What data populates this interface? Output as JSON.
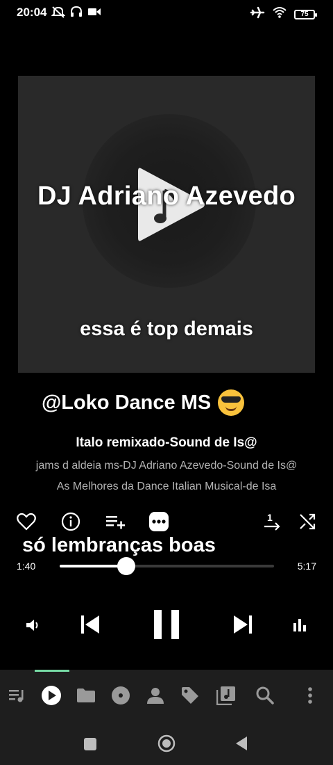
{
  "status_bar": {
    "time": "20:04",
    "battery": "75",
    "left_icons": [
      "mute-icon",
      "headphones-icon",
      "video-icon"
    ],
    "right_icons": [
      "airplane-icon",
      "wifi-icon",
      "battery-icon"
    ]
  },
  "artwork": {
    "title": "DJ Adriano Azevedo",
    "caption": "essa é top demais"
  },
  "overlay_texts": [
    "@Loko Dance MS",
    "só lembranças boas"
  ],
  "song": {
    "title": "Italo remixado-Sound de Is@",
    "artist": "jams d aldeia ms-DJ Adriano Azevedo-Sound de Is@",
    "album": "As Melhores da Dance Italian Musical-de Isa"
  },
  "actions": [
    "heart-icon",
    "info-icon",
    "add-to-playlist-icon",
    "more-icon",
    "repeat-one-icon",
    "shuffle-icon"
  ],
  "playback": {
    "current_time": "1:40",
    "total_time": "5:17",
    "progress": 0.31
  },
  "controls": [
    "volume-icon",
    "previous-icon",
    "pause-icon",
    "next-icon",
    "equalizer-icon"
  ],
  "bottom_nav": {
    "items": [
      "queue-icon",
      "now-playing-icon",
      "folder-icon",
      "album-icon",
      "artist-icon",
      "tag-icon",
      "library-icon",
      "search-icon",
      "overflow-menu-icon"
    ],
    "active_index": 1
  },
  "colors": {
    "background": "#000000",
    "panel": "#1e1e1e",
    "accent": "#76d9a4",
    "secondary_text": "#b3b3b3"
  }
}
